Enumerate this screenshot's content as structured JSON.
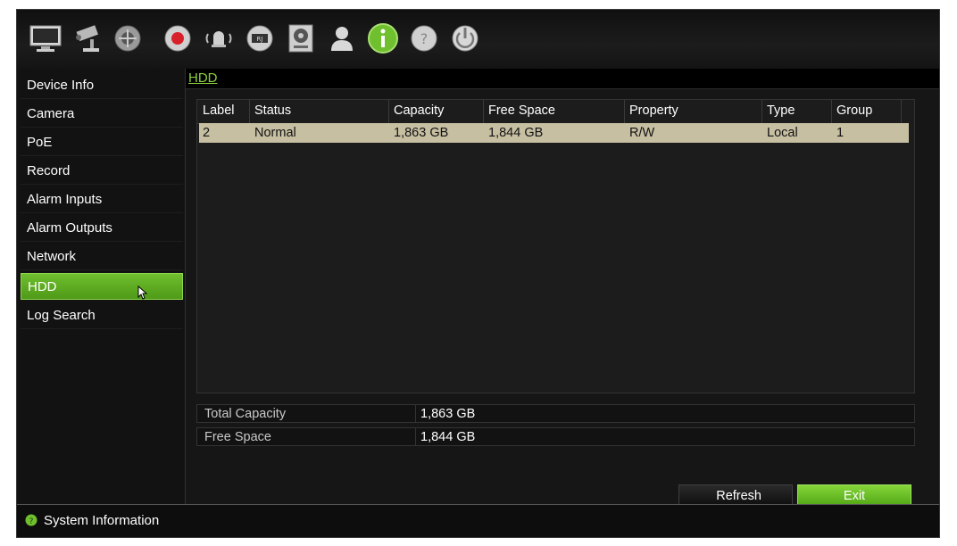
{
  "toolbar": {
    "icons": [
      "monitor-icon",
      "camera-icon",
      "ptz-dome-icon",
      "record-icon",
      "alarm-icon",
      "network-icon",
      "hdd-icon",
      "user-icon",
      "info-icon",
      "help-icon",
      "power-icon"
    ],
    "active_icon": "info-icon",
    "accent": "#6fbf2e"
  },
  "sidebar": {
    "items": [
      {
        "label": "Device Info"
      },
      {
        "label": "Camera"
      },
      {
        "label": "PoE"
      },
      {
        "label": "Record"
      },
      {
        "label": "Alarm Inputs"
      },
      {
        "label": "Alarm Outputs"
      },
      {
        "label": "Network"
      },
      {
        "label": "HDD"
      },
      {
        "label": "Log Search"
      }
    ],
    "active": "HDD"
  },
  "breadcrumb": "HDD",
  "table": {
    "columns": [
      "Label",
      "Status",
      "Capacity",
      "Free Space",
      "Property",
      "Type",
      "Group"
    ],
    "rows": [
      {
        "label": "2",
        "status": "Normal",
        "capacity": "1,863 GB",
        "free_space": "1,844 GB",
        "property": "R/W",
        "type": "Local",
        "group": "1"
      }
    ]
  },
  "summary": {
    "total_capacity_label": "Total Capacity",
    "total_capacity_value": "1,863 GB",
    "free_space_label": "Free Space",
    "free_space_value": "1,844 GB"
  },
  "buttons": {
    "refresh": "Refresh",
    "exit": "Exit"
  },
  "statusbar": {
    "text": "System Information"
  }
}
